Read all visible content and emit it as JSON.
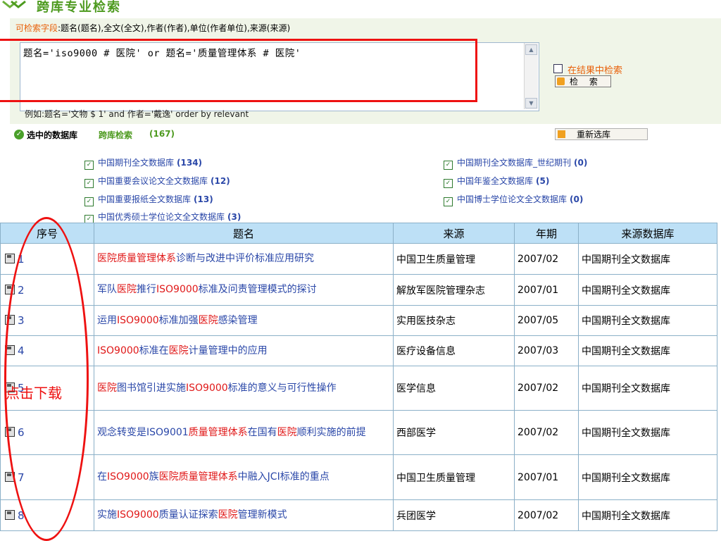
{
  "header": {
    "title": "跨库专业检索"
  },
  "search": {
    "fields_label": "可检索字段",
    "fields_text": ":题名(题名),全文(全文),作者(作者),单位(作者单位),来源(来源)",
    "query": "题名='iso9000 # 医院' or 题名='质量管理体系 # 医院'",
    "in_result_label": "在结果中检索",
    "search_button": "检 索",
    "example": "例如:题名='文物 $ 1' and 作者='戴逸' order by relevant"
  },
  "selected": {
    "label": "选中的数据库",
    "cross_label": "跨库检索",
    "count": "(167)",
    "reselect_button": "重新选库",
    "databases": [
      {
        "name": "中国期刊全文数据库",
        "count": "(134)"
      },
      {
        "name": "中国期刊全文数据库_世纪期刊",
        "count": "(0)"
      },
      {
        "name": "中国重要会议论文全文数据库",
        "count": "(12)"
      },
      {
        "name": "中国年鉴全文数据库",
        "count": "(5)"
      },
      {
        "name": "中国重要报纸全文数据库",
        "count": "(13)"
      },
      {
        "name": "中国博士学位论文全文数据库",
        "count": "(0)"
      },
      {
        "name": "中国优秀硕士学位论文全文数据库",
        "count": "(3)"
      }
    ]
  },
  "table": {
    "headers": [
      "序号",
      "题名",
      "来源",
      "年期",
      "来源数据库"
    ],
    "rows": [
      {
        "num": "1",
        "title": [
          [
            "医院质量管理体系",
            1
          ],
          [
            "诊断与改进中评价标准应用研究",
            0
          ]
        ],
        "source": "中国卫生质量管理",
        "issue": "2007/02",
        "db": "中国期刊全文数据库"
      },
      {
        "num": "2",
        "title": [
          [
            "军队",
            0
          ],
          [
            "医院",
            1
          ],
          [
            "推行",
            0
          ],
          [
            "ISO9000",
            1
          ],
          [
            "标准及问责管理模式的探讨",
            0
          ]
        ],
        "source": "解放军医院管理杂志",
        "issue": "2007/01",
        "db": "中国期刊全文数据库"
      },
      {
        "num": "3",
        "title": [
          [
            "运用",
            0
          ],
          [
            "ISO9000",
            1
          ],
          [
            "标准加强",
            0
          ],
          [
            "医院",
            1
          ],
          [
            "感染管理",
            0
          ]
        ],
        "source": "实用医技杂志",
        "issue": "2007/05",
        "db": "中国期刊全文数据库"
      },
      {
        "num": "4",
        "title": [
          [
            "ISO9000",
            1
          ],
          [
            "标准在",
            0
          ],
          [
            "医院",
            1
          ],
          [
            "计量管理中的应用",
            0
          ]
        ],
        "source": "医疗设备信息",
        "issue": "2007/03",
        "db": "中国期刊全文数据库"
      },
      {
        "num": "5",
        "title": [
          [
            "医院",
            1
          ],
          [
            "图书馆引进实施",
            0
          ],
          [
            "ISO9000",
            1
          ],
          [
            "标准的意义与可行性操作",
            0
          ]
        ],
        "source": "医学信息",
        "issue": "2007/02",
        "db": "中国期刊全文数据库"
      },
      {
        "num": "6",
        "title": [
          [
            "观念转变是ISO9001",
            0
          ],
          [
            "质量管理体系",
            1
          ],
          [
            "在国有",
            0
          ],
          [
            "医院",
            1
          ],
          [
            "顺利实施的前提",
            0
          ]
        ],
        "source": "西部医学",
        "issue": "2007/02",
        "db": "中国期刊全文数据库"
      },
      {
        "num": "7",
        "title": [
          [
            "在",
            0
          ],
          [
            "ISO9000",
            1
          ],
          [
            "族",
            0
          ],
          [
            "医院质量管理体系",
            1
          ],
          [
            "中融入JCI标准的重点",
            0
          ]
        ],
        "source": "中国卫生质量管理",
        "issue": "2007/01",
        "db": "中国期刊全文数据库"
      },
      {
        "num": "8",
        "title": [
          [
            "实施",
            0
          ],
          [
            "ISO9000",
            1
          ],
          [
            "质量认证探索",
            0
          ],
          [
            "医院",
            1
          ],
          [
            "管理新模式",
            0
          ]
        ],
        "source": "兵团医学",
        "issue": "2007/02",
        "db": "中国期刊全文数据库"
      }
    ]
  },
  "annotation": {
    "text": "点击下载"
  }
}
